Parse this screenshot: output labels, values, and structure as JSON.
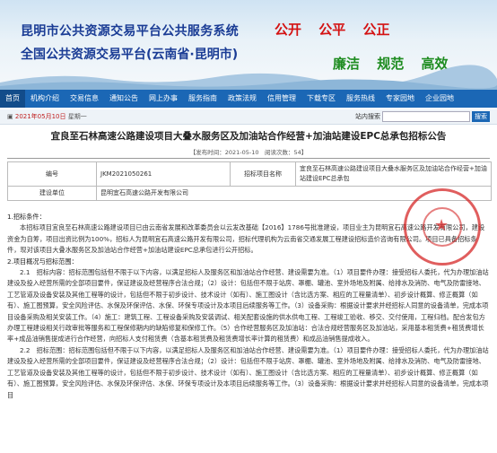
{
  "header": {
    "title_line1": "昆明市公共资源交易平台公共服务系统",
    "title_line2": "全国公共资源交易平台(云南省·昆明市)",
    "mottos_red": [
      "公开",
      "公平",
      "公正"
    ],
    "mottos_green": [
      "廉洁",
      "规范",
      "高效"
    ]
  },
  "nav": {
    "items": [
      "首页",
      "机构介绍",
      "交易信息",
      "通知公告",
      "网上办事",
      "服务指南",
      "政策法规",
      "信用管理",
      "下载专区",
      "服务热线",
      "专家园地",
      "企业园地"
    ]
  },
  "subbar": {
    "date_prefix": "2021年05月10日",
    "date_weekday": "星期一",
    "search_label": "站内搜索",
    "search_button": "搜索"
  },
  "article": {
    "title": "宜良至石林高速公路建设项目大叠水服务区及加油站合作经营+加油站建设EPC总承包招标公告",
    "meta": "【发布时间：2021-05-10　阅读次数：54】",
    "table": {
      "row1": {
        "label1": "编号",
        "value1": "JKM2021050261",
        "label2": "招标项目名称",
        "value2": "宜良至石林高速公路建设项目大叠水服务区及加油站合作经营+加油站建设EPC总承包"
      },
      "row2": {
        "label": "建设单位",
        "value": "昆明宜石高速公路开发有限公司"
      }
    },
    "sections": {
      "h1": "1.招标条件：",
      "p1": "本招标项目宜良至石林高速公路建设项目已由云南省发展和改革委员会以云发改基础【2016】1786号批准建设，项目业主为昆明宜石高速公路开发有限公司，建设资金为自筹，项目出资比例为100%，招标人为昆明宜石高速公路开发有限公司，招标代理机构为云南省交通发展工程建设招标造价咨询有限公司。项目已具备招标条件，现对该项目大叠水服务区及加油站合作经营+加油站建设EPC总承包进行公开招标。",
      "h2": "2.项目概况与招标范围：",
      "p2": "2.1　招标内容：招标范围包括但不限于以下内容，以满足招标人及服务区和加油站合作经营、建设需要为准。（1）项目要件办理：接受招标人委托，代为办理加油站建设及投入经营所需的全部项目要件，保证建设及经营程序合法合规；（2）设计：包括但不限于站房、罩棚、罐池、室外场地及附属、给排水及消防、电气及防雷接地、工艺管道及设备安装及其他工程等的设计，包括但不限于初步设计、技术设计（如有）、施工图设计（含比选方案、相应的工程量清单）、初步设计概算、修正概算（如有）、施工图预算，安全风险评估、水保及环保评估、水保、环保专项设计及本项目后续服务等工作。（3）设备采购：根据设计要求并经招标人同意的设备清单，完成本项目设备采购及相关安装工作。（4）施工：建筑工程、工程设备采购及安装调试、相关配套设施的供水供电工程、工程竣工验收、移交、交付使用，工程归档。配合发包方办理工程建设相关行政审批等服务和工程保修期内的缺陷修复和保修工作。（5）合作经营服务区及加油站：合法合规经营服务区及加油站，采用基本租赁费+租赁费增长率+成品油销售提成进行合作经营，向招标人支付租赁费（含基本租赁费及租赁费增长率计算的租赁费）和成品油销售提成收入。",
      "p3": "2.2　招标范围：招标范围包括但不限于以下内容，以满足招标人及服务区和加油站合作经营、建设需要为准。（1）项目要件办理：接受招标人委托，代为办理加油站建设及投入经营所需的全部项目要件，保证建设及经营程序合法合规；（2）设计：包括但不限于站房、罩棚、罐池、室外场地及附属、给排水及消防、电气及防雷接地、工艺管道及设备安装及其他工程等的设计，包括但不限于初步设计、技术设计（如有）、施工图设计（含比选方案、相应的工程量清单）、初步设计概算、修正概算（如有）、施工图预算，安全风险评估、水保及环保评估、水保、环保专项设计及本项目后续服务等工作。（3）设备采购：根据设计要求并经招标人同意的设备清单，完成本项目"
    }
  },
  "colors": {
    "nav_bg": "#1b67b5",
    "title_blue": "#1a3c95",
    "motto_red": "#d41212",
    "motto_green": "#1e8c20"
  }
}
